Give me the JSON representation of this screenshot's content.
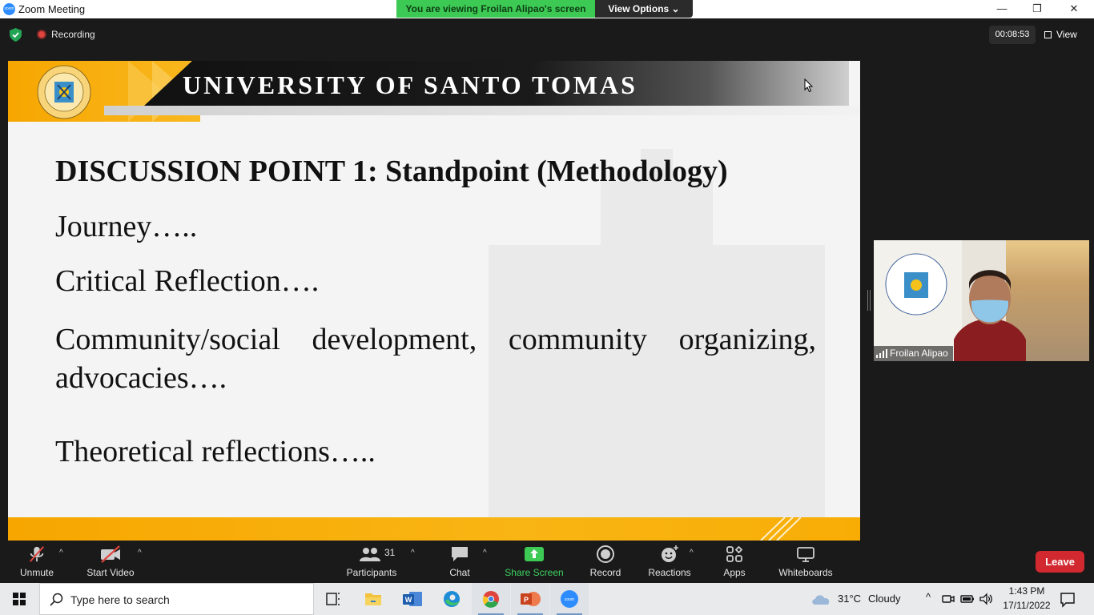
{
  "window": {
    "title": "Zoom Meeting",
    "app_icon_text": "zoom",
    "minimize": "—",
    "restore": "❐",
    "close": "✕"
  },
  "share_banner": {
    "viewing": "You are viewing Froilan Alipao's screen",
    "view_options": "View Options ⌄"
  },
  "meeting": {
    "recording_label": "Recording",
    "timer": "00:08:53",
    "view_label": "View"
  },
  "slide": {
    "header_title": "UNIVERSITY OF SANTO TOMAS",
    "heading": "DISCUSSION POINT 1: Standpoint (Methodology)",
    "lines": [
      "Journey…..",
      "Critical Reflection….",
      "Community/social development, community organizing, advocacies….",
      "Theoretical reflections….."
    ]
  },
  "participant_tile": {
    "name": "Froilan Alipao"
  },
  "toolbar": {
    "unmute": "Unmute",
    "start_video": "Start Video",
    "participants": "Participants",
    "participants_count": "31",
    "chat": "Chat",
    "share_screen": "Share Screen",
    "record": "Record",
    "reactions": "Reactions",
    "apps": "Apps",
    "whiteboards": "Whiteboards",
    "leave": "Leave",
    "caret": "^"
  },
  "taskbar": {
    "search_placeholder": "Type here to search",
    "weather_temp": "31°C",
    "weather_desc": "Cloudy",
    "time": "1:43 PM",
    "date": "17/11/2022",
    "tray_chevron": "^"
  },
  "colors": {
    "share_green": "#3cc954",
    "leave_red": "#d2282f",
    "ust_gold": "#f7a600"
  }
}
